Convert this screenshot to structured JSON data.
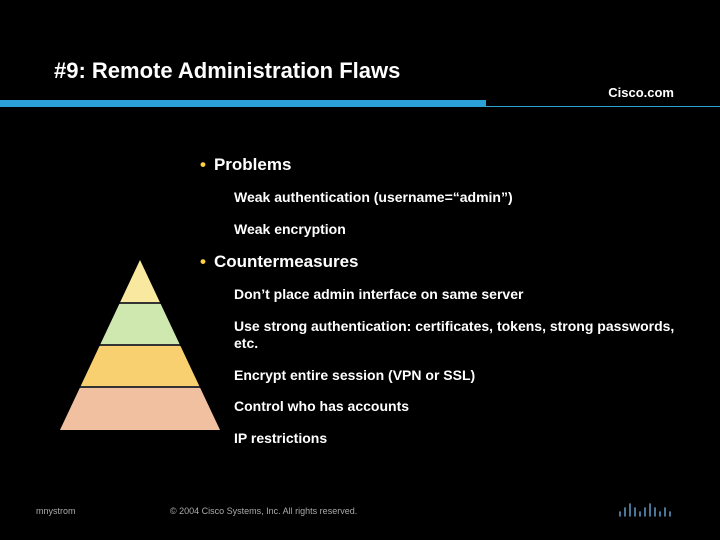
{
  "title": "#9: Remote Administration Flaws",
  "brand": "Cisco.com",
  "sections": [
    {
      "heading": "Problems",
      "items": [
        "Weak authentication (username=“admin”)",
        "Weak encryption"
      ]
    },
    {
      "heading": "Countermeasures",
      "items": [
        "Don’t place admin interface on same server",
        "Use strong authentication: certificates, tokens, strong passwords, etc.",
        "Encrypt entire session (VPN or SSL)",
        "Control who has accounts",
        "IP restrictions"
      ]
    }
  ],
  "footer": {
    "author": "mnystrom",
    "copyright": "© 2004 Cisco Systems, Inc. All rights reserved."
  },
  "pyramid_colors": [
    "#f8e8a0",
    "#cfe8b0",
    "#f8d070",
    "#f0c0a0"
  ]
}
